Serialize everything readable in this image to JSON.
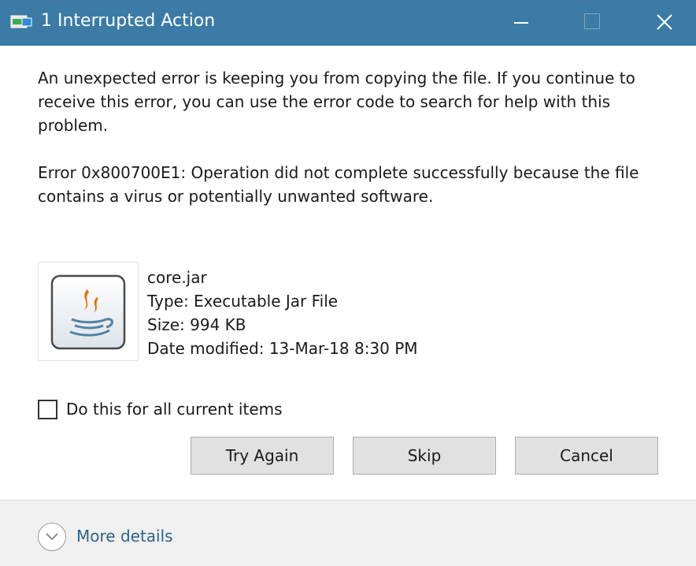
{
  "window": {
    "title": "1 Interrupted Action",
    "accent_color": "#3b7ba5",
    "icons": {
      "title": "file-copy-icon",
      "minimize": "minimize-icon",
      "maximize": "maximize-icon",
      "close": "close-icon"
    }
  },
  "message": "An unexpected error is keeping you from copying the file. If you continue to receive this error, you can use the error code to search for help with this problem.",
  "error": "Error 0x800700E1: Operation did not complete successfully because the file contains a virus or potentially unwanted software.",
  "file": {
    "icon": "java-jar-icon",
    "name": "core.jar",
    "type": "Type: Executable Jar File",
    "size": "Size: 994 KB",
    "date_modified": "Date modified: 13-Mar-18 8:30 PM"
  },
  "apply_all": {
    "label": "Do this for all current items",
    "checked": false
  },
  "buttons": {
    "try_again": "Try Again",
    "skip": "Skip",
    "cancel": "Cancel"
  },
  "footer": {
    "more_details": "More details",
    "icon": "chevron-down-icon"
  }
}
